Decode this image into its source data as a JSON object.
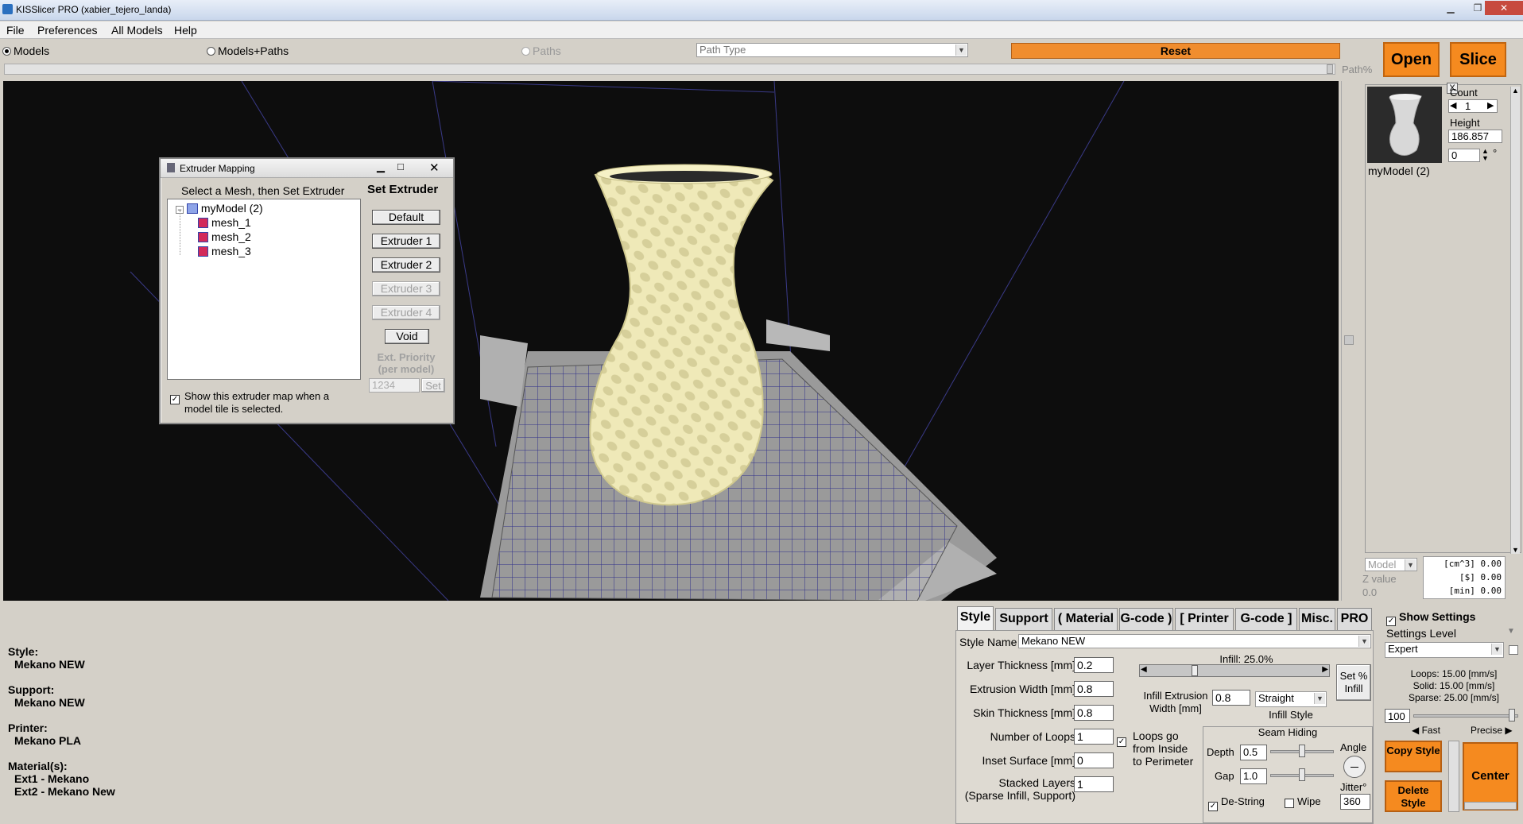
{
  "window": {
    "title": "KISSlicer PRO (xabier_tejero_landa)"
  },
  "menu": [
    "File",
    "Preferences",
    "All Models",
    "Help"
  ],
  "toolbar": {
    "radio_models": "Models",
    "radio_models_paths": "Models+Paths",
    "radio_paths": "Paths",
    "path_type_placeholder": "Path Type",
    "reset_label": "Reset",
    "path_pct_label": "Path%",
    "open_label": "Open",
    "slice_label": "Slice"
  },
  "right_panel": {
    "close": "X",
    "count_label": "Count",
    "count_value": "1",
    "height_label": "Height",
    "height_value": "186.857",
    "rotation_value": "0",
    "degree": "°",
    "model_name": "myModel (2)",
    "mode_select": "Model",
    "z_value_label": "Z value",
    "z_value": "0.0",
    "stats": [
      "[cm^3] 0.00",
      "[$] 0.00",
      "[min] 0.00"
    ]
  },
  "dialog": {
    "title": "Extruder Mapping",
    "instruction": "Select a Mesh, then Set Extruder",
    "set_extruder_title": "Set Extruder",
    "tree_root": "myModel (2)",
    "meshes": [
      "mesh_1",
      "mesh_2",
      "mesh_3"
    ],
    "buttons": [
      {
        "label": "Default",
        "enabled": true
      },
      {
        "label": "Extruder 1",
        "enabled": true
      },
      {
        "label": "Extruder 2",
        "enabled": true
      },
      {
        "label": "Extruder 3",
        "enabled": false
      },
      {
        "label": "Extruder 4",
        "enabled": false
      },
      {
        "label": "Void",
        "enabled": true
      }
    ],
    "priority_label": "Ext. Priority (per model)",
    "priority_placeholder": "1234",
    "set_label": "Set",
    "checkbox_label_1": "Show this extruder map when a",
    "checkbox_label_2": "model tile is selected."
  },
  "info": [
    {
      "label": "Style:",
      "values": [
        "Mekano NEW"
      ]
    },
    {
      "label": "Support:",
      "values": [
        "Mekano NEW"
      ]
    },
    {
      "label": "Printer:",
      "values": [
        "Mekano PLA"
      ]
    },
    {
      "label": "Material(s):",
      "values": [
        "Ext1 - Mekano",
        "Ext2 - Mekano New"
      ]
    }
  ],
  "tabs": [
    "Style",
    "Support",
    "( Material",
    "G-code )",
    "[ Printer",
    "G-code ]",
    "Misc.",
    "PRO"
  ],
  "settings": {
    "style_name_label": "Style Name",
    "style_name_value": "Mekano NEW",
    "layer_thickness_label": "Layer Thickness [mm]",
    "layer_thickness_value": "0.2",
    "extrusion_width_label": "Extrusion Width [mm]",
    "extrusion_width_value": "0.8",
    "skin_thickness_label": "Skin Thickness [mm]",
    "skin_thickness_value": "0.8",
    "loops_label": "Number of Loops",
    "loops_value": "1",
    "inset_label": "Inset  Surface [mm]",
    "inset_value": "0",
    "stacked_label_1": "Stacked Layers",
    "stacked_label_2": "(Sparse Infill, Support)",
    "stacked_value": "1",
    "loops_order_1": "Loops go",
    "loops_order_2": "from Inside",
    "loops_order_3": "to Perimeter",
    "infill_label": "Infill: 25.0%",
    "infill_fraction": 0.25,
    "set_pct_1": "Set %",
    "set_pct_2": "Infill",
    "infill_width_label_1": "Infill Extrusion",
    "infill_width_label_2": "Width [mm]",
    "infill_width_value": "0.8",
    "infill_style_value": "Straight",
    "infill_style_label": "Infill Style",
    "seam_hiding_label": "Seam Hiding",
    "depth_label": "Depth",
    "depth_value": "0.5",
    "gap_label": "Gap",
    "gap_value": "1.0",
    "angle_label": "Angle",
    "jitter_label": "Jitter°",
    "jitter_value": "360",
    "destring_label": "De-String",
    "wipe_label": "Wipe"
  },
  "side_controls": {
    "show_settings_label": "Show Settings",
    "settings_level_label": "Settings Level",
    "settings_level_value": "Expert",
    "speeds": [
      "Loops:  15.00 [mm/s]",
      "Solid:  15.00 [mm/s]",
      "Sparse: 25.00 [mm/s]"
    ],
    "speed_value": "100",
    "fast_label": "Fast",
    "precise_label": "Precise",
    "copy_style": "Copy Style",
    "delete_style": "Delete Style",
    "center_label": "Center"
  },
  "colors": {
    "accent_orange": "#f58a1f",
    "viewport_bg": "#0d0d0d",
    "model_color": "#f3efc2",
    "bed_color": "#8a8a8a",
    "grid_color": "#2a2a80"
  }
}
